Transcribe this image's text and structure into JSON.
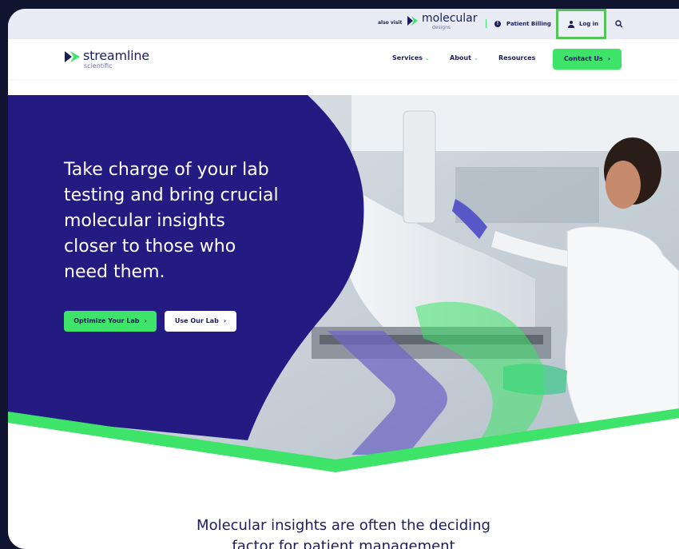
{
  "topbar": {
    "also_visit": "also visit",
    "partner_name": "molecular",
    "partner_sub": "designs",
    "billing_icon": "!",
    "billing_label": "Patient Billing",
    "login_label": "Log in"
  },
  "nav": {
    "logo_name": "streamline",
    "logo_sub": "scientific",
    "caret": "⌄",
    "items": [
      {
        "label": "Services"
      },
      {
        "label": "About"
      },
      {
        "label": "Resources"
      }
    ],
    "contact_label": "Contact Us"
  },
  "hero": {
    "headline": "Take charge of your lab\ntesting and bring crucial\nmolecular insights\ncloser to those who\nneed them.",
    "primary_cta": "Optimize Your Lab",
    "secondary_cta": "Use Our Lab",
    "chevron": "›"
  },
  "section": {
    "heading_line1": "Molecular insights are often the deciding",
    "heading_line2": "factor for patient management"
  },
  "colors": {
    "navy": "#1b1e5c",
    "brand_blue": "#231a82",
    "accent_green": "#3ee36a",
    "highlight_outline": "#55c35a"
  },
  "icons": [
    "molecular-chevron-icon",
    "info-icon",
    "user-icon",
    "search-icon",
    "streamline-chevron-icon",
    "chevron-down-icon",
    "chevron-right-icon"
  ]
}
